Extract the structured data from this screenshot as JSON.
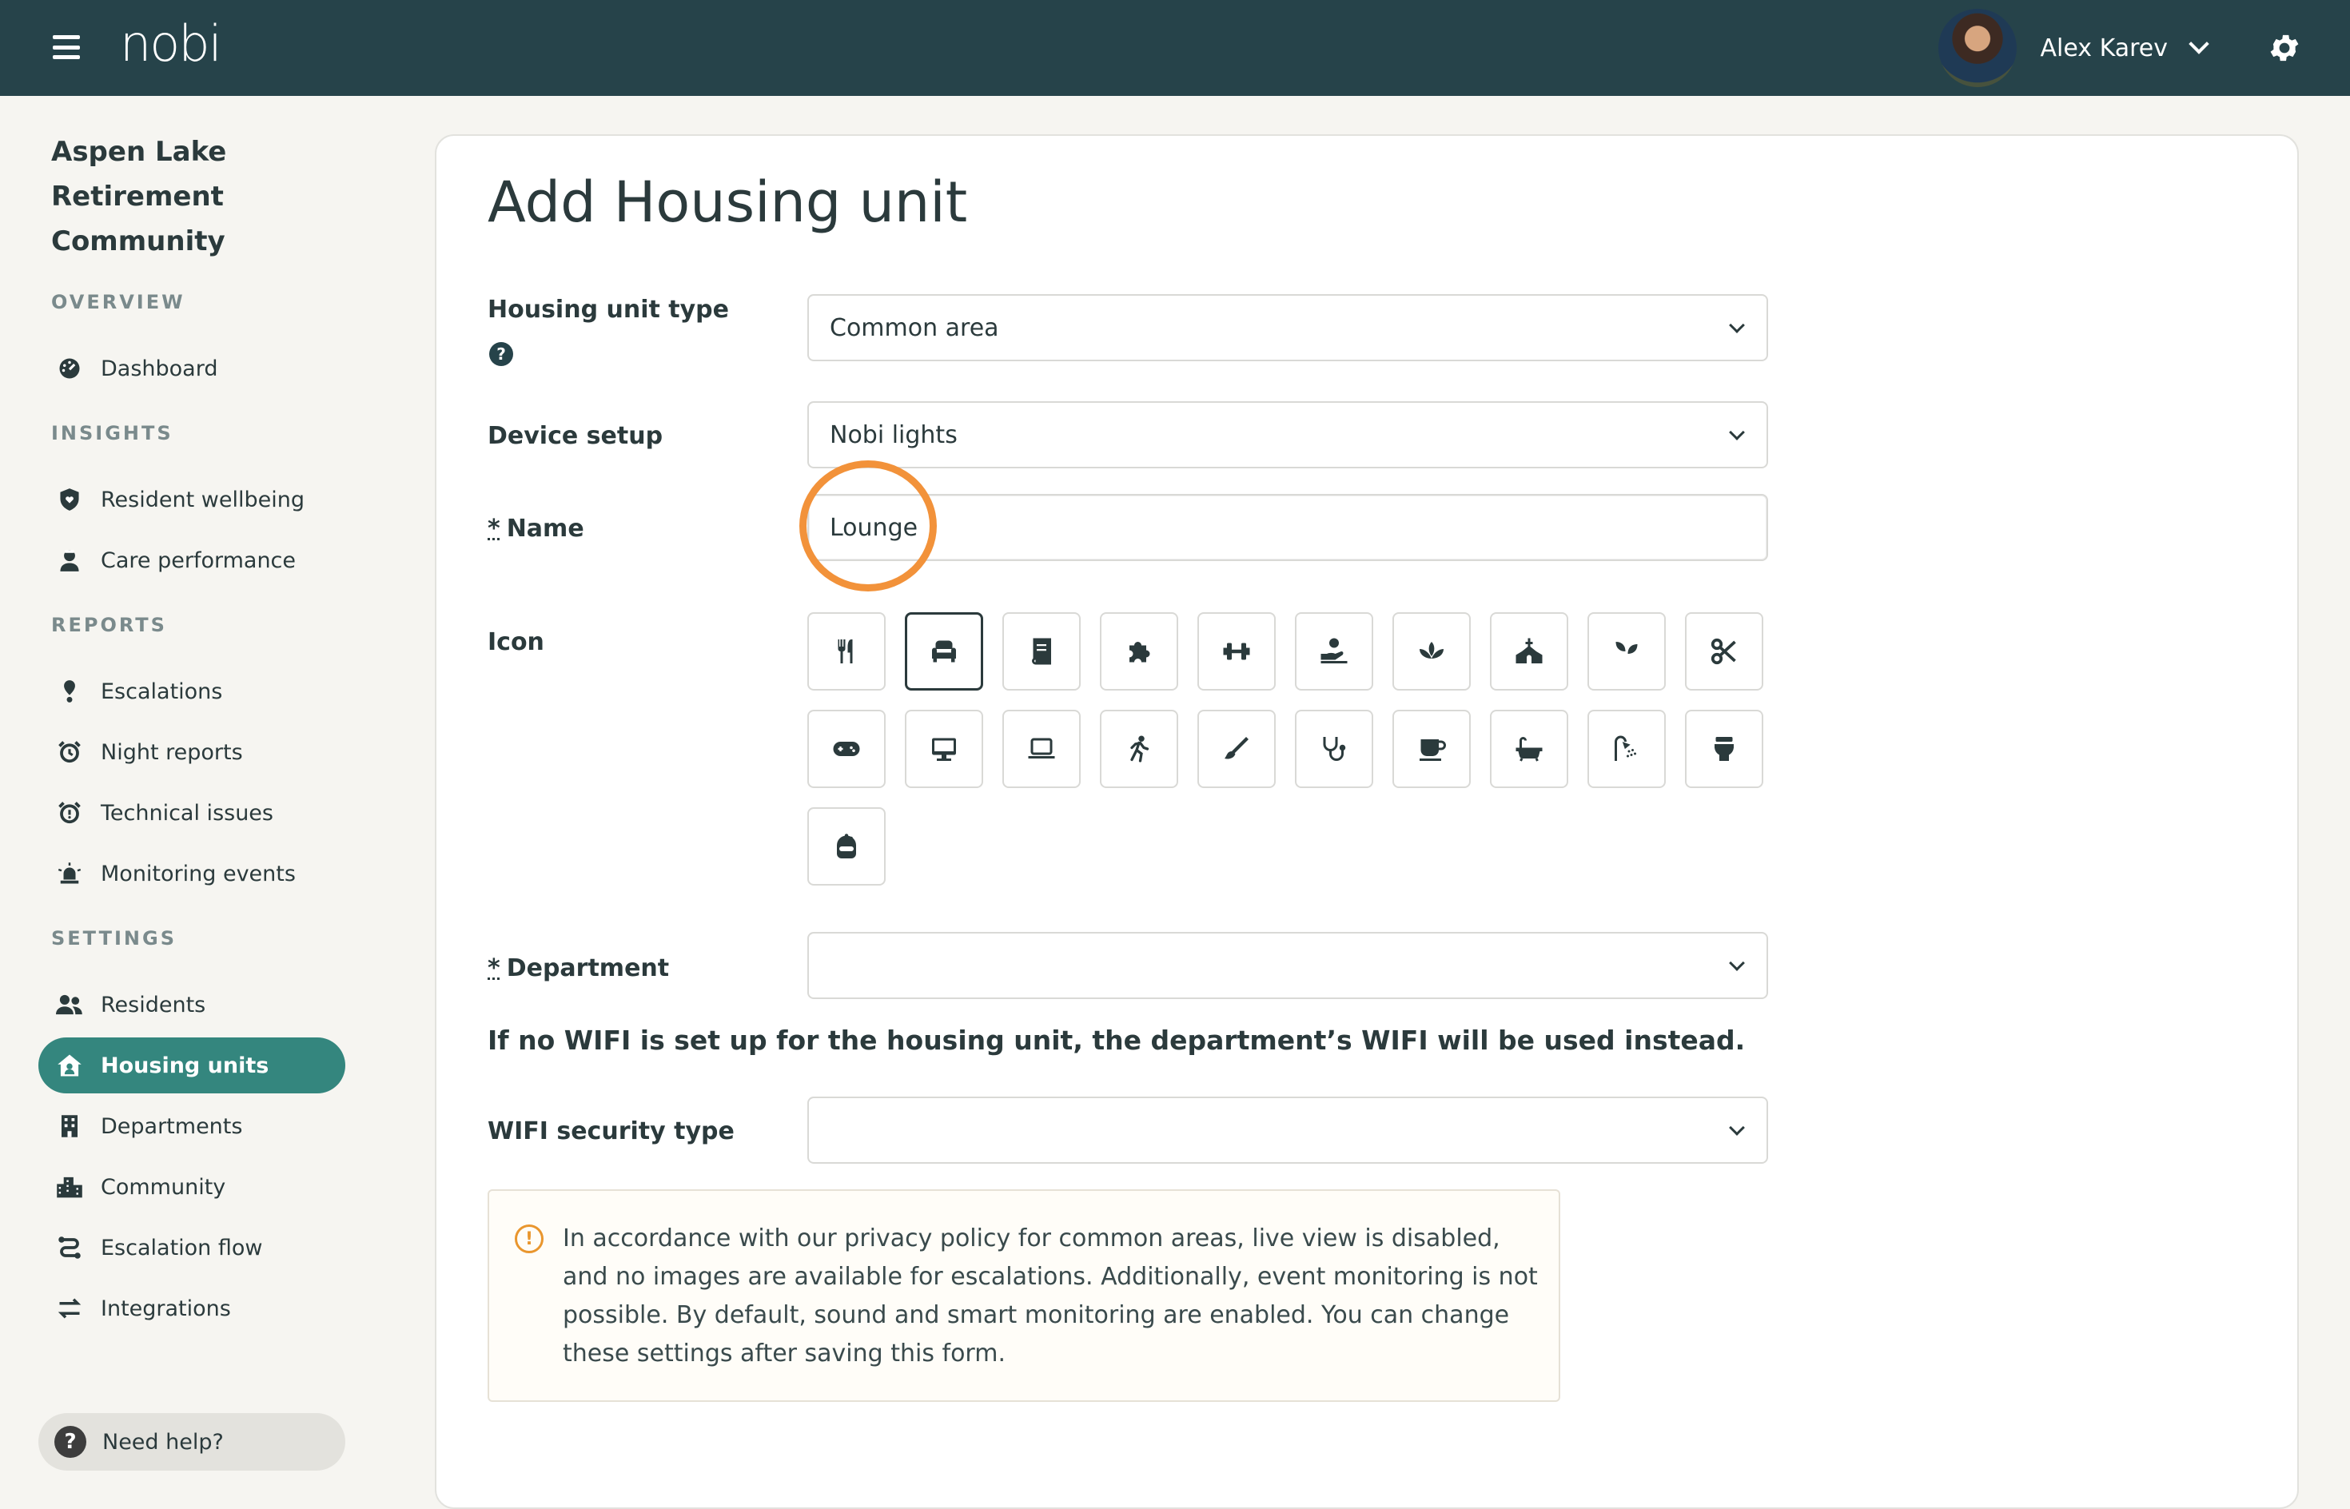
{
  "topbar": {
    "logo": "nobi",
    "user_name": "Alex Karev"
  },
  "sidebar": {
    "community": "Aspen Lake Retirement Community",
    "sections": {
      "overview": "OVERVIEW",
      "insights": "INSIGHTS",
      "reports": "REPORTS",
      "settings": "SETTINGS"
    },
    "items": {
      "dashboard": "Dashboard",
      "resident_wellbeing": "Resident wellbeing",
      "care_performance": "Care performance",
      "escalations": "Escalations",
      "night_reports": "Night reports",
      "technical_issues": "Technical issues",
      "monitoring_events": "Monitoring events",
      "residents": "Residents",
      "housing_units": "Housing units",
      "departments": "Departments",
      "community": "Community",
      "escalation_flow": "Escalation flow",
      "integrations": "Integrations"
    },
    "help": "Need help?",
    "accent": "#34867e"
  },
  "form": {
    "title": "Add Housing unit",
    "housing_unit_type_label": "Housing unit type",
    "housing_unit_type_value": "Common area",
    "device_setup_label": "Device setup",
    "device_setup_value": "Nobi lights",
    "name_label": "Name",
    "name_value": "Lounge",
    "required_mark": "*",
    "icon_label": "Icon",
    "department_label": "Department",
    "department_value": "",
    "wifi_note": "If no WIFI is set up for the housing unit, the department’s WIFI will be used instead.",
    "wifi_security_label": "WIFI security type",
    "wifi_security_value": "",
    "privacy_notice": "In accordance with our privacy policy for common areas, live view is disabled, and no images are available for escalations. Additionally, event monitoring is not possible. By default, sound and smart monitoring are enabled. You can change these settings after saving this form.",
    "selected_icon": "sofa-icon",
    "icons": [
      "utensils-icon",
      "sofa-icon",
      "book-icon",
      "puzzle-icon",
      "dumbbell-icon",
      "care-hand-icon",
      "lotus-icon",
      "church-icon",
      "seedling-icon",
      "scissors-icon",
      "gamepad-icon",
      "desktop-icon",
      "laptop-icon",
      "running-icon",
      "paintbrush-icon",
      "stethoscope-icon",
      "coffee-icon",
      "bath-icon",
      "shower-icon",
      "toilet-icon",
      "washing-icon"
    ]
  }
}
